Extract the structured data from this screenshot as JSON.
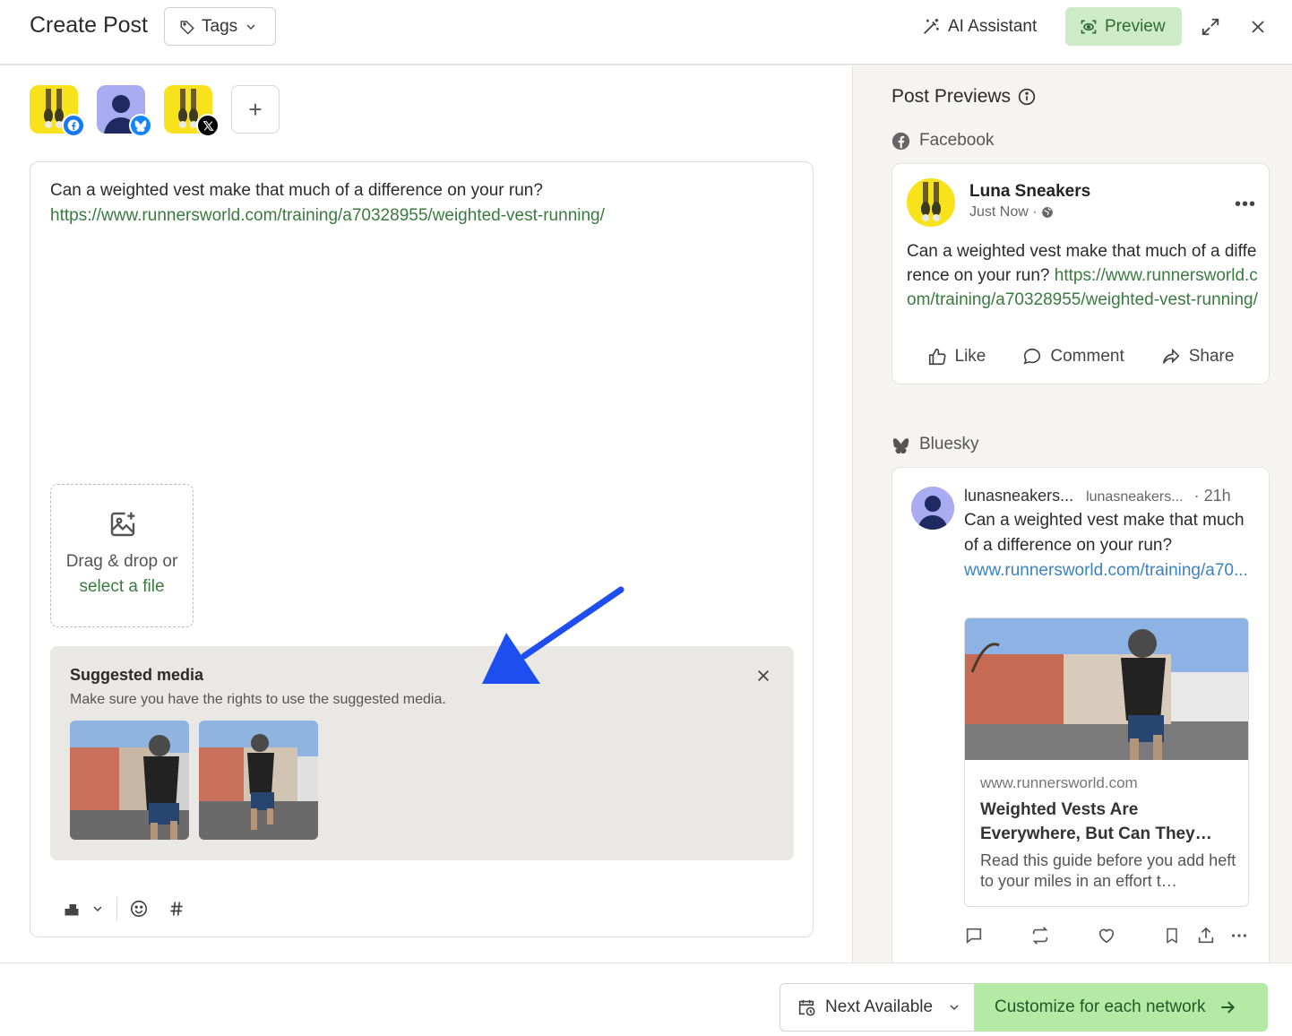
{
  "header": {
    "title": "Create Post",
    "tags_label": "Tags",
    "ai_assistant_label": "AI Assistant",
    "preview_label": "Preview"
  },
  "editor": {
    "text_line1": "Can a weighted vest make that much of a difference on your run?",
    "link": "https://www.runnersworld.com/training/a70328955/weighted-vest-running/",
    "dropzone_text": "Drag & drop or",
    "dropzone_link": "select a file"
  },
  "suggested_media": {
    "title": "Suggested media",
    "subtitle": "Make sure you have the rights to use the suggested media."
  },
  "preview_panel": {
    "title": "Post Previews",
    "facebook": {
      "network_label": "Facebook",
      "name": "Luna Sneakers",
      "time": "Just Now ·",
      "text_line1": "Can a weighted vest make that much of a difference on your run?",
      "link": "https://www.runnersworld.com/training/a70328955/weighted-vest-running/",
      "like": "Like",
      "comment": "Comment",
      "share": "Share"
    },
    "bluesky": {
      "network_label": "Bluesky",
      "display_name": "lunasneakers...",
      "handle": "lunasneakers...",
      "time": "· 21h",
      "text": "Can a weighted vest make that much of a difference on your run?",
      "link": "www.runnersworld.com/training/a70...",
      "embed_domain": "www.runnersworld.com",
      "embed_title": "Weighted Vests Are Everywhere, But Can They…",
      "embed_desc": "Read this guide before you add heft to your miles in an effort t…"
    }
  },
  "footer": {
    "next_available": "Next Available",
    "customize": "Customize for each network"
  },
  "colors": {
    "accent_green": "#cdebc6",
    "link_green": "#3a7a3f",
    "cta_green": "#b5e9a6",
    "annotation_arrow": "#1f4ef0"
  }
}
